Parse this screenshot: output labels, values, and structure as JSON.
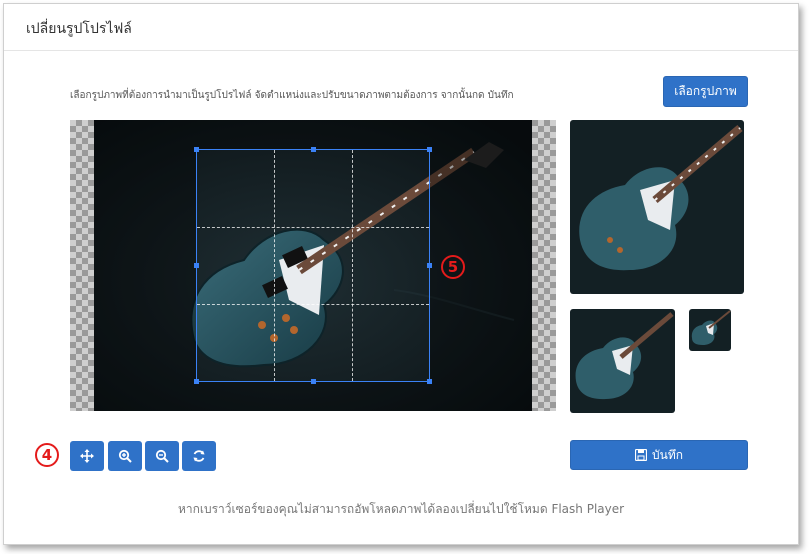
{
  "dialog": {
    "title": "เปลี่ยนรูปโปรไฟล์",
    "instructions": "เลือกรูปภาพที่ต้องการนำมาเป็นรูปโปรไฟล์ จัดตำแหน่งและปรับขนาดภาพตามต้องการ จากนั้นกด บันทึก",
    "choose_button": "เลือกรูปภาพ",
    "save_button": "บันทึก",
    "footer_note": "หากเบราว์เซอร์ของคุณไม่สามารถอัพโหลดภาพได้ลองเปลี่ยนไปใช้โหมด Flash Player"
  },
  "annotations": {
    "marker_4": "4",
    "marker_5": "5"
  },
  "toolbar": {
    "tools": [
      {
        "name": "move-tool-button",
        "icon": "move-arrows-icon"
      },
      {
        "name": "zoom-in-button",
        "icon": "zoom-in-icon"
      },
      {
        "name": "zoom-out-button",
        "icon": "zoom-out-icon"
      },
      {
        "name": "reset-button",
        "icon": "refresh-icon"
      }
    ]
  },
  "colors": {
    "primary": "#2f72c8",
    "crop_border": "#3b82f6",
    "marker": "#e41b1b"
  }
}
